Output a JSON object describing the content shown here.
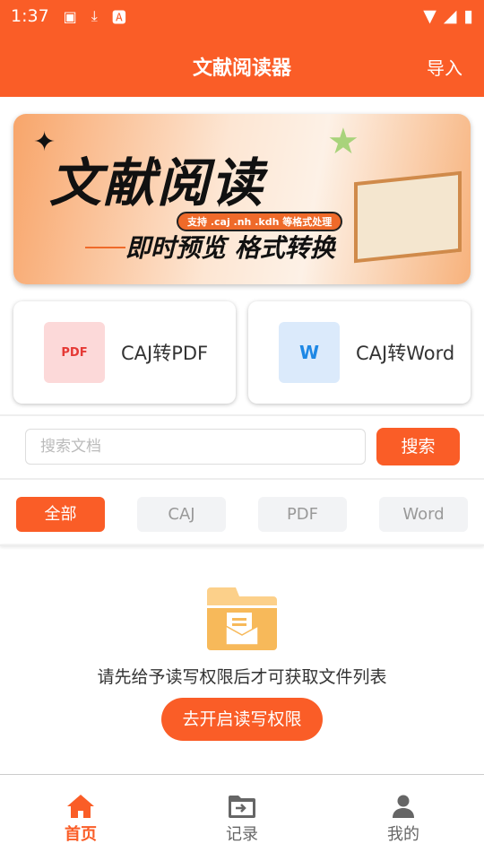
{
  "status": {
    "time": "1:37",
    "icons": [
      "image-icon",
      "download-icon",
      "a-text-icon"
    ],
    "right_icons": [
      "wifi-icon",
      "signal-icon",
      "battery-charging-icon"
    ]
  },
  "header": {
    "title": "文献阅读器",
    "import_label": "导入"
  },
  "banner": {
    "title": "文献阅读",
    "pill": "支持 .caj .nh .kdh 等格式处理",
    "subtitle": "即时预览 格式转换"
  },
  "cards": [
    {
      "label": "CAJ转PDF",
      "icon": "pdf-file-icon",
      "icon_text": "PDF",
      "color": "#e53935"
    },
    {
      "label": "CAJ转Word",
      "icon": "word-file-icon",
      "icon_text": "W",
      "color": "#1e88e5"
    }
  ],
  "search": {
    "placeholder": "搜索文档",
    "button": "搜索"
  },
  "filters": [
    {
      "label": "全部",
      "active": true
    },
    {
      "label": "CAJ"
    },
    {
      "label": "PDF"
    },
    {
      "label": "Word"
    }
  ],
  "empty": {
    "message": "请先给予读写权限后才可获取文件列表",
    "button": "去开启读写权限"
  },
  "nav": [
    {
      "label": "首页",
      "icon": "home-icon",
      "active": true
    },
    {
      "label": "记录",
      "icon": "folder-arrow-icon"
    },
    {
      "label": "我的",
      "icon": "person-icon"
    }
  ],
  "colors": {
    "accent": "#fa5d27"
  }
}
